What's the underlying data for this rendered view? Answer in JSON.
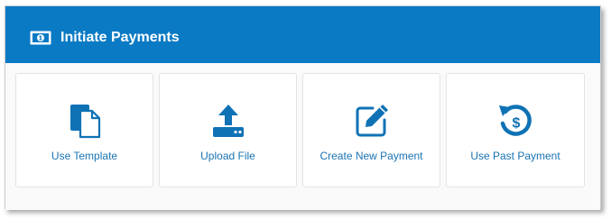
{
  "colors": {
    "header_bg": "#0a7ac4",
    "header_text": "#ffffff",
    "tile_text": "#1a73b3",
    "icon": "#0f72b5"
  },
  "header": {
    "icon": "money-bill-icon",
    "title": "Initiate Payments"
  },
  "tiles": [
    {
      "label": "Use Template",
      "icon": "template-document-icon"
    },
    {
      "label": "Upload File",
      "icon": "upload-tray-icon"
    },
    {
      "label": "Create New Payment",
      "icon": "edit-pencil-icon"
    },
    {
      "label": "Use Past Payment",
      "icon": "history-dollar-icon"
    }
  ]
}
